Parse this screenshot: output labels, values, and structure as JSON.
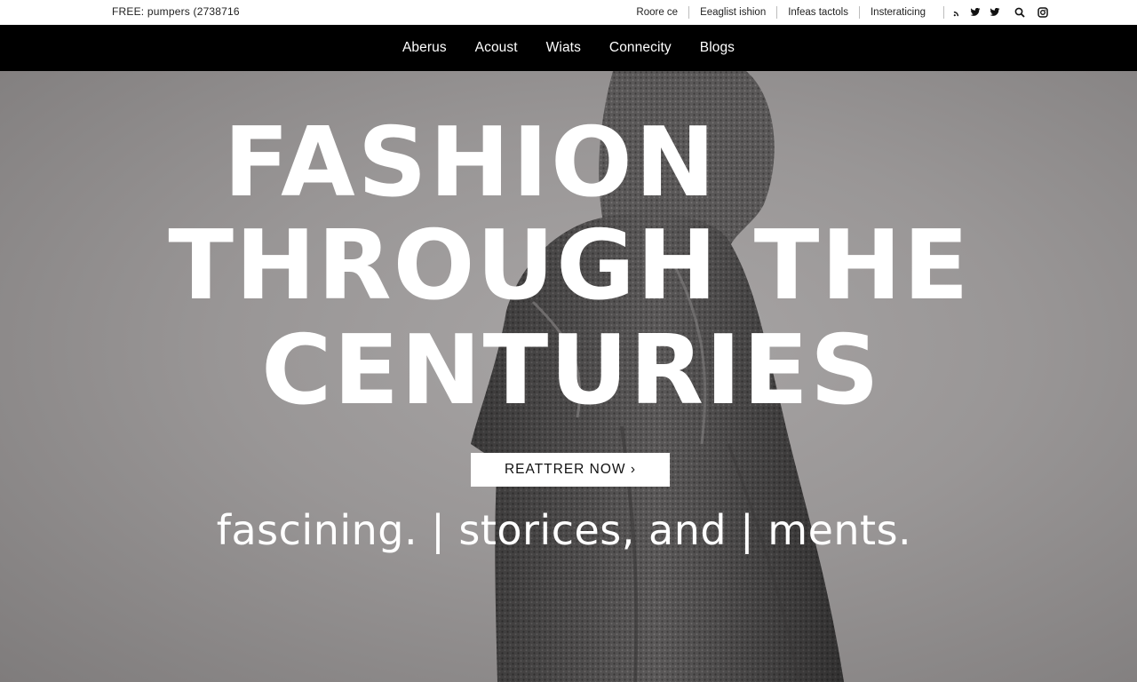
{
  "utility_bar": {
    "promo_text": "FREE: pumpers (2738716",
    "links": [
      {
        "label": "Roore ce"
      },
      {
        "label": "Eeaglist ishion"
      },
      {
        "label": "Infeas tactols"
      },
      {
        "label": "Insteraticing"
      }
    ],
    "social_icons": [
      "rss-icon",
      "twitter-icon",
      "twitter-icon"
    ],
    "tool_icons": [
      "search-icon",
      "instagram-icon"
    ]
  },
  "main_nav": {
    "items": [
      {
        "label": "Aberus"
      },
      {
        "label": "Acoust"
      },
      {
        "label": "Wiats"
      },
      {
        "label": "Connecity"
      },
      {
        "label": "Blogs"
      }
    ]
  },
  "hero": {
    "title_line_1": "FASHION",
    "title_line_2": "THROUGH THE",
    "title_line_3": "CENTURIES",
    "cta_label": "REATTRER NOW ›",
    "tagline": "fascining. | storices, and | ments."
  },
  "colors": {
    "nav_background": "#000000",
    "hero_background": "#9c9999",
    "text_on_hero": "#ffffff"
  }
}
